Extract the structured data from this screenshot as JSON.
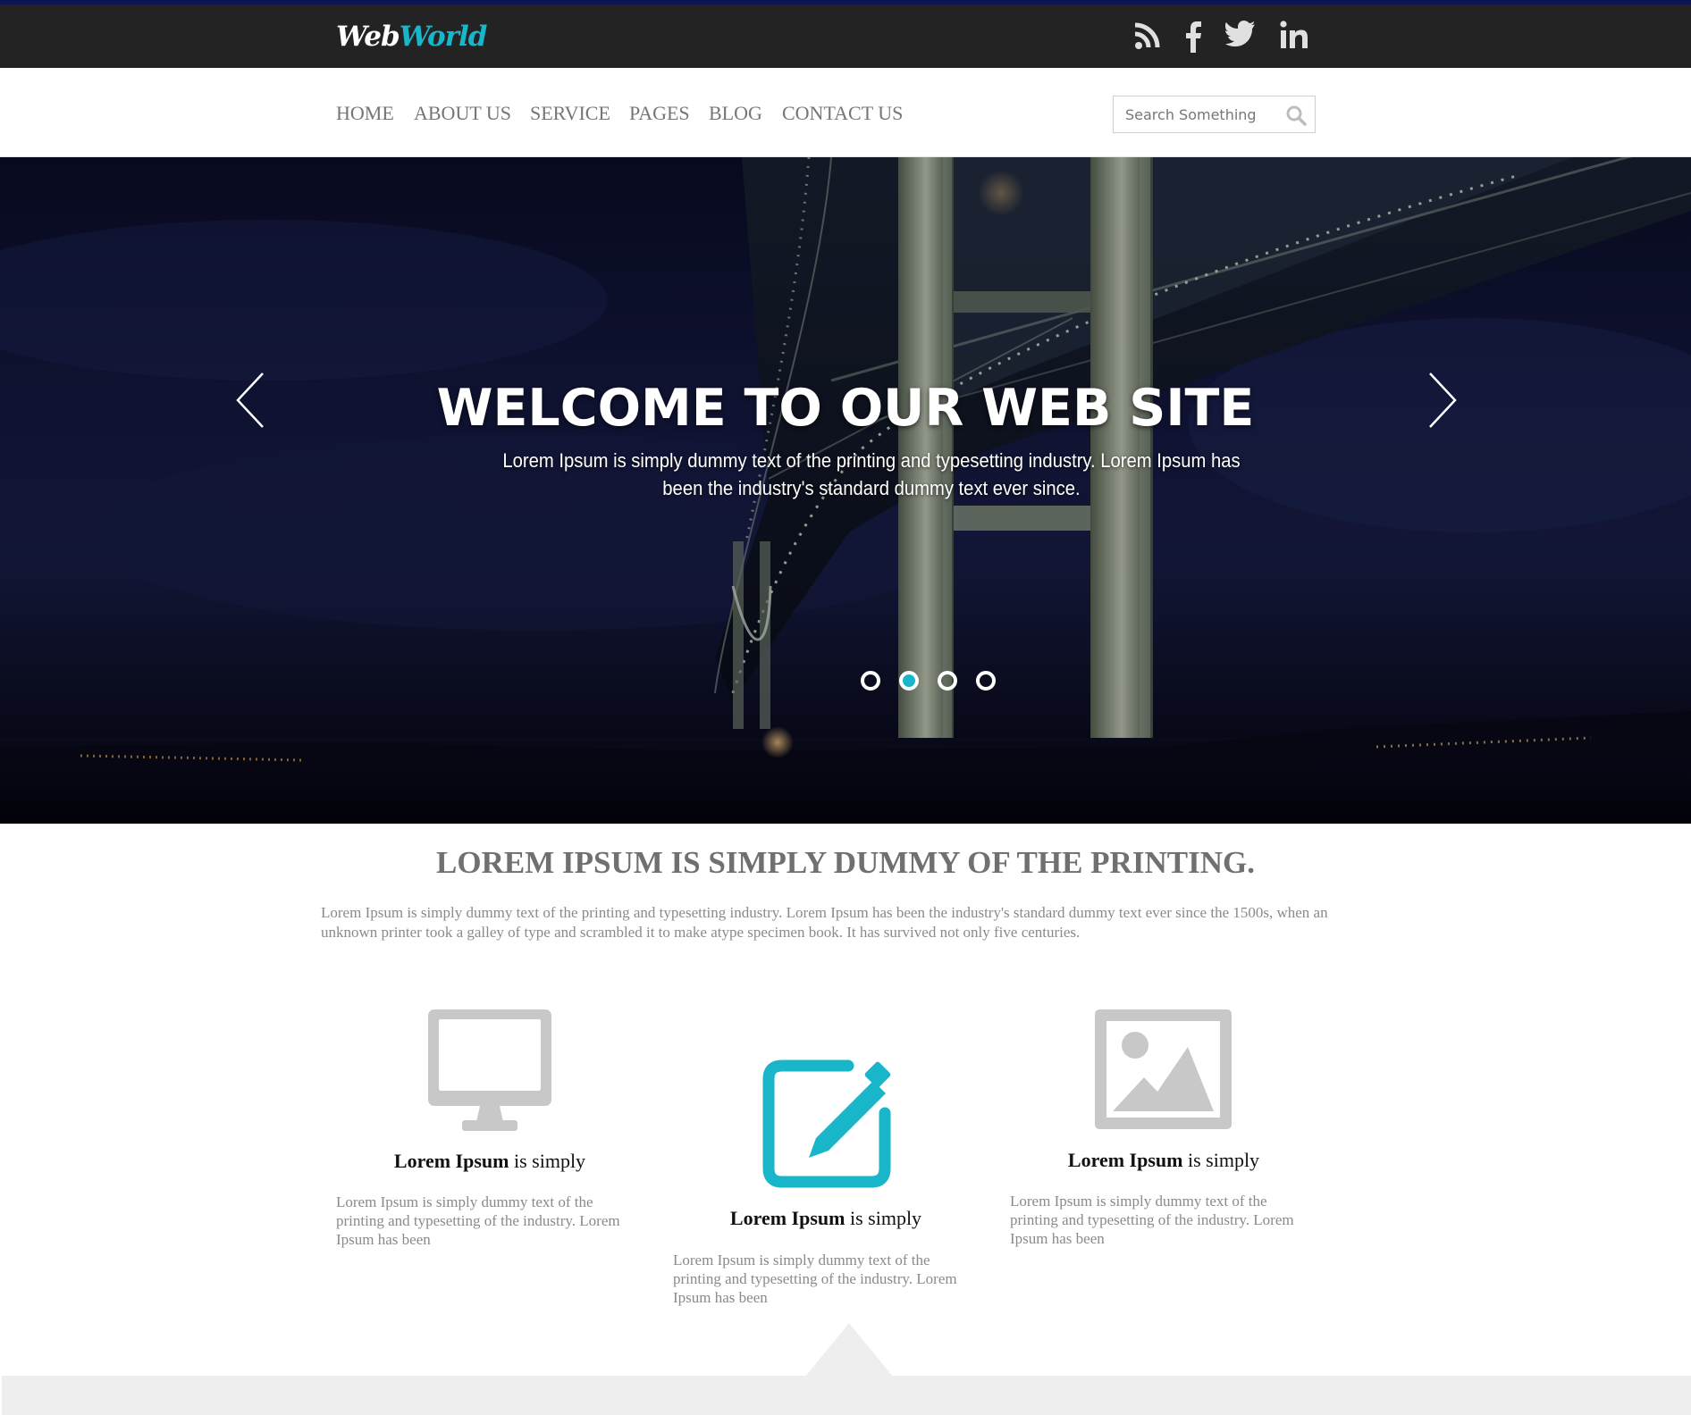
{
  "brand": {
    "logo_part1": "Web",
    "logo_part2": "World"
  },
  "social": [
    "rss-icon",
    "facebook-icon",
    "twitter-icon",
    "linkedin-icon"
  ],
  "nav": {
    "items": [
      "HOME",
      "ABOUT US",
      "SERVICE",
      "PAGES",
      "BLOG",
      "CONTACT US"
    ]
  },
  "search": {
    "placeholder": "Search Something"
  },
  "hero": {
    "title": "WELCOME TO OUR WEB SITE",
    "subtitle": "Lorem Ipsum is simply dummy text of the printing and typesetting industry. Lorem Ipsum has been the industry's standard dummy text ever since.",
    "slide_count": 4,
    "active_slide": 2
  },
  "intro": {
    "title": "LOREM IPSUM IS SIMPLY DUMMY OF THE PRINTING.",
    "text": "Lorem Ipsum is simply dummy text of the printing and typesetting industry. Lorem Ipsum has been the industry's standard dummy text ever since the 1500s, when an unknown printer took a galley of type and scrambled it to make atype specimen book. It has survived not only five centuries."
  },
  "features": [
    {
      "icon": "monitor-icon",
      "title_bold": "Lorem Ipsum",
      "title_rest": " is simply",
      "text": "Lorem Ipsum is simply dummy text of the printing and typesetting of the industry. Lorem Ipsum has been"
    },
    {
      "icon": "edit-icon",
      "title_bold": "Lorem Ipsum",
      "title_rest": " is simply",
      "text": "Lorem Ipsum is simply dummy text of the printing and typesetting of the industry. Lorem Ipsum has been"
    },
    {
      "icon": "image-icon",
      "title_bold": "Lorem Ipsum",
      "title_rest": " is simply",
      "text": "Lorem Ipsum is simply dummy text of the printing and typesetting of the industry. Lorem Ipsum has been"
    }
  ],
  "colors": {
    "accent": "#19b6c9",
    "topbar": "#232323",
    "icon_gray": "#c8c8c8"
  }
}
